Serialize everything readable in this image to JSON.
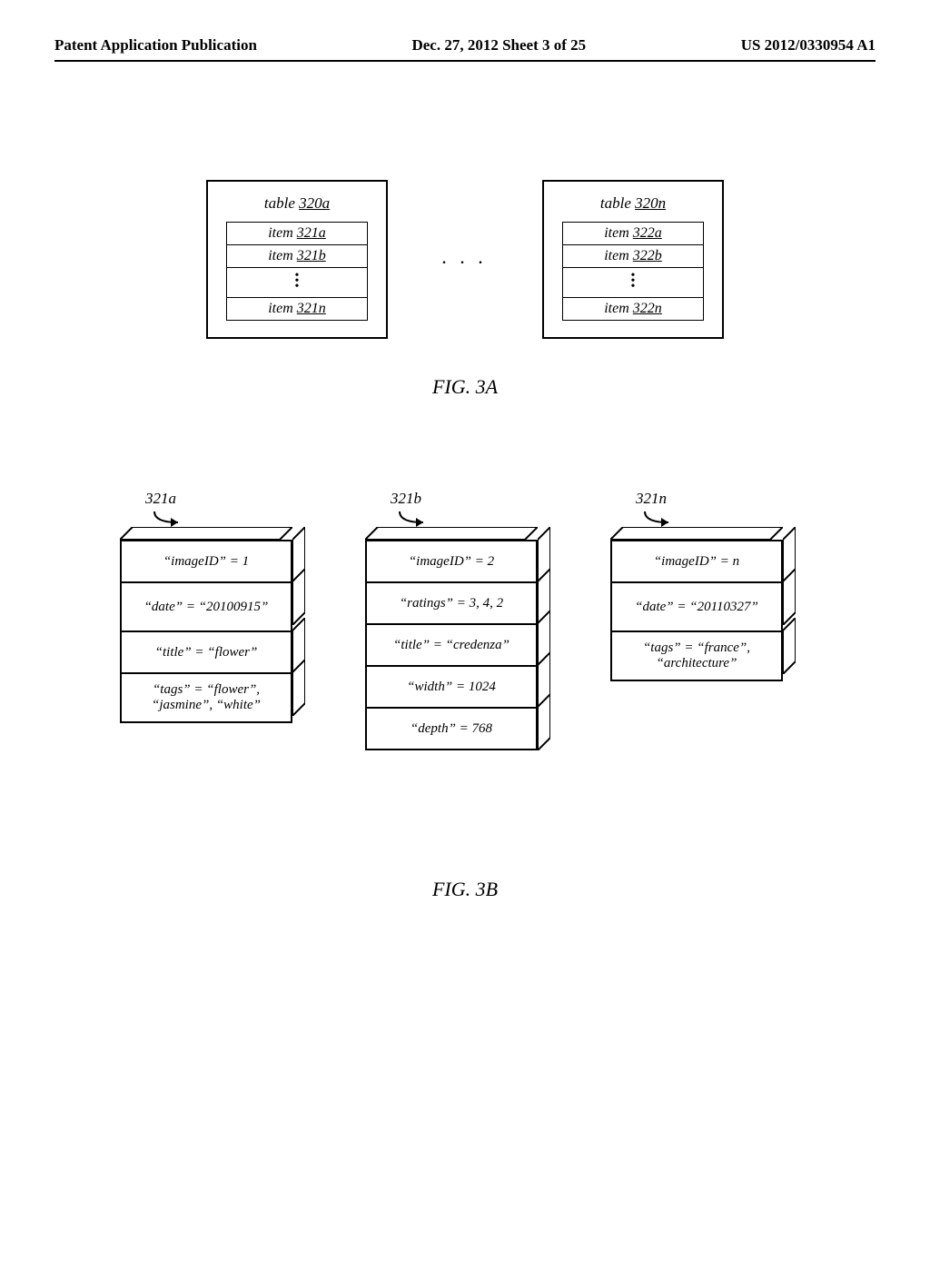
{
  "header": {
    "left": "Patent Application Publication",
    "center": "Dec. 27, 2012  Sheet 3 of 25",
    "right": "US 2012/0330954 A1"
  },
  "fig3a": {
    "caption": "FIG. 3A",
    "ellipsis": ". . .",
    "tables": [
      {
        "title_prefix": "table ",
        "title_ref": "320a",
        "items": [
          {
            "prefix": "item ",
            "ref": "321a"
          },
          {
            "prefix": "item ",
            "ref": "321b"
          },
          {
            "prefix": "item ",
            "ref": "321n"
          }
        ]
      },
      {
        "title_prefix": "table ",
        "title_ref": "320n",
        "items": [
          {
            "prefix": "item ",
            "ref": "322a"
          },
          {
            "prefix": "item ",
            "ref": "322b"
          },
          {
            "prefix": "item ",
            "ref": "322n"
          }
        ]
      }
    ]
  },
  "fig3b": {
    "caption": "FIG. 3B",
    "blocks": [
      {
        "label": "321a",
        "rows": [
          "“imageID” = 1",
          "“date” = “20100915”",
          "“title” = “flower”",
          "“tags” = “flower”, “jasmine”, “white”"
        ]
      },
      {
        "label": "321b",
        "rows": [
          "“imageID” = 2",
          "“ratings” = 3, 4, 2",
          "“title” = “credenza”",
          "“width” = 1024",
          "“depth” = 768"
        ]
      },
      {
        "label": "321n",
        "rows": [
          "“imageID” = n",
          "“date” = “20110327”",
          "“tags” = “france”, “architecture”"
        ]
      }
    ]
  }
}
